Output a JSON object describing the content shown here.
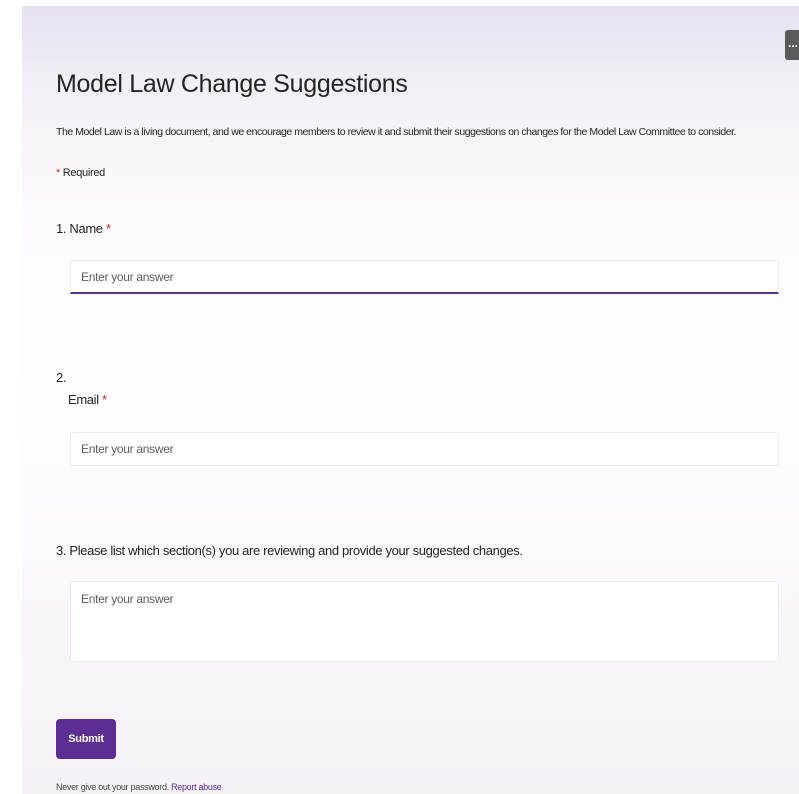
{
  "header": {
    "more_button": "..."
  },
  "form": {
    "title": "Model Law Change Suggestions",
    "description": "The Model Law is a living document, and we encourage members to review it and submit their suggestions on changes for the Model Law Committee to consider.",
    "required_marker": "*",
    "required_note": "Required",
    "questions": [
      {
        "label": "1. Name",
        "required_marker": "*",
        "value": "",
        "placeholder": "Enter your answer"
      },
      {
        "number": "2.",
        "label": "Email",
        "required_marker": "*",
        "value": "",
        "placeholder": "Enter your answer"
      },
      {
        "label": "3. Please list which section(s) you are reviewing and provide your suggested changes.",
        "value": "",
        "placeholder": "Enter your answer"
      }
    ],
    "submit_label": "Submit"
  },
  "footer": {
    "text": "Never give out your password.",
    "report_link": "Report abuse"
  },
  "colors": {
    "accent": "#5c2e91",
    "required": "#c42b1c"
  }
}
